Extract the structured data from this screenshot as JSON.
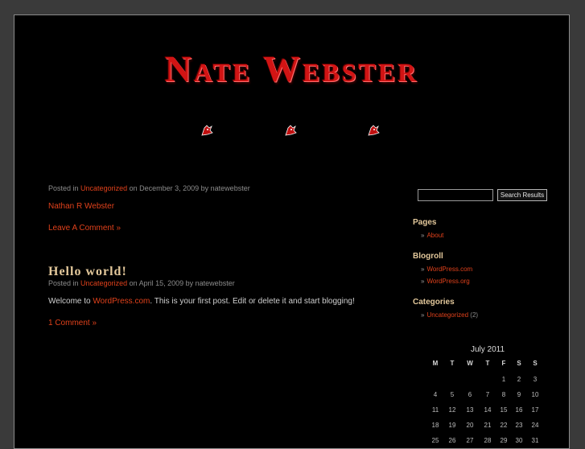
{
  "site": {
    "title": "Nate Webster"
  },
  "posts": [
    {
      "meta": {
        "prefix": "Posted in",
        "category": "Uncategorized",
        "on": "on December 3, 2009 by natewebster"
      },
      "content_link": "Nathan R Webster",
      "comment_link": "Leave A Comment »"
    },
    {
      "title": "Hello world!",
      "meta": {
        "prefix": "Posted in",
        "category": "Uncategorized",
        "on": "on April 15, 2009 by natewebster"
      },
      "body_prefix": "Welcome to",
      "body_link": "WordPress.com",
      "body_suffix": ". This is your first post. Edit or delete it and start blogging!",
      "comment_link": "1 Comment »"
    }
  ],
  "sidebar": {
    "search": {
      "value": "",
      "button": "Search Results"
    },
    "pages": {
      "title": "Pages",
      "items": [
        "About"
      ]
    },
    "blogroll": {
      "title": "Blogroll",
      "items": [
        "WordPress.com",
        "WordPress.org"
      ]
    },
    "categories": {
      "title": "Categories",
      "items": [
        {
          "label": "Uncategorized",
          "count": "(2)"
        }
      ]
    }
  },
  "calendar": {
    "caption": "July 2011",
    "days": [
      "M",
      "T",
      "W",
      "T",
      "F",
      "S",
      "S"
    ],
    "weeks": [
      [
        "",
        "",
        "",
        "",
        "1",
        "2",
        "3"
      ],
      [
        "4",
        "5",
        "6",
        "7",
        "8",
        "9",
        "10"
      ],
      [
        "11",
        "12",
        "13",
        "14",
        "15",
        "16",
        "17"
      ],
      [
        "18",
        "19",
        "20",
        "21",
        "22",
        "23",
        "24"
      ],
      [
        "25",
        "26",
        "27",
        "28",
        "29",
        "30",
        "31"
      ]
    ]
  },
  "icons": {
    "bullet": "»",
    "header_ornament": "devil-icon"
  },
  "colors": {
    "link": "#e0411b",
    "heading": "#e3c89b",
    "title_red": "#d11414",
    "background": "#000000"
  }
}
